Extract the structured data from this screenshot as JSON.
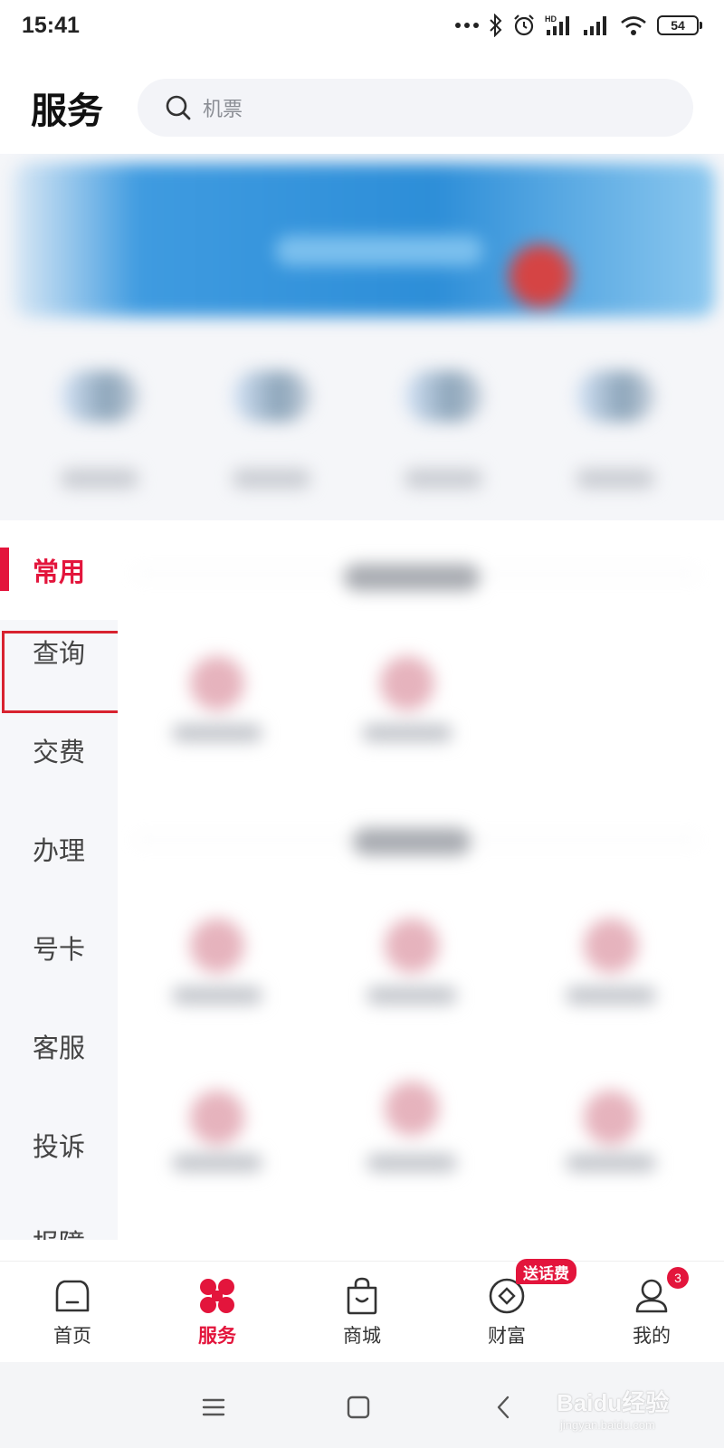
{
  "status_bar": {
    "time": "15:41",
    "battery_level": "54",
    "network_label": "HD",
    "icons": [
      "more-dots-icon",
      "bluetooth-icon",
      "alarm-icon",
      "hd-signal-icon",
      "signal-icon",
      "wifi-icon",
      "battery-icon"
    ]
  },
  "header": {
    "title": "服务",
    "search_placeholder": "机票"
  },
  "side_nav": {
    "items": [
      {
        "label": "常用",
        "active": true
      },
      {
        "label": "查询",
        "active": false,
        "highlighted": true
      },
      {
        "label": "交费",
        "active": false
      },
      {
        "label": "办理",
        "active": false
      },
      {
        "label": "号卡",
        "active": false
      },
      {
        "label": "客服",
        "active": false
      },
      {
        "label": "投诉",
        "active": false
      },
      {
        "label": "报障",
        "active": false
      }
    ]
  },
  "tab_bar": {
    "tabs": [
      {
        "label": "首页",
        "icon": "home-icon",
        "active": false
      },
      {
        "label": "服务",
        "icon": "services-icon",
        "active": true
      },
      {
        "label": "商城",
        "icon": "shopping-bag-icon",
        "active": false
      },
      {
        "label": "财富",
        "icon": "wealth-coin-icon",
        "active": false
      },
      {
        "label": "我的",
        "icon": "profile-icon",
        "active": false
      }
    ],
    "promo_badge": "送话费",
    "profile_badge_count": "3"
  },
  "system_nav": {
    "buttons": [
      "menu-icon",
      "home-square-icon",
      "back-icon"
    ]
  },
  "watermark": {
    "main": "Baidu经验",
    "sub": "jingyan.baidu.com"
  },
  "colors": {
    "accent": "#e3153c",
    "highlight_box": "#d8222f",
    "sidebar_bg": "#f6f7fa",
    "search_bg": "#f3f4f8"
  }
}
